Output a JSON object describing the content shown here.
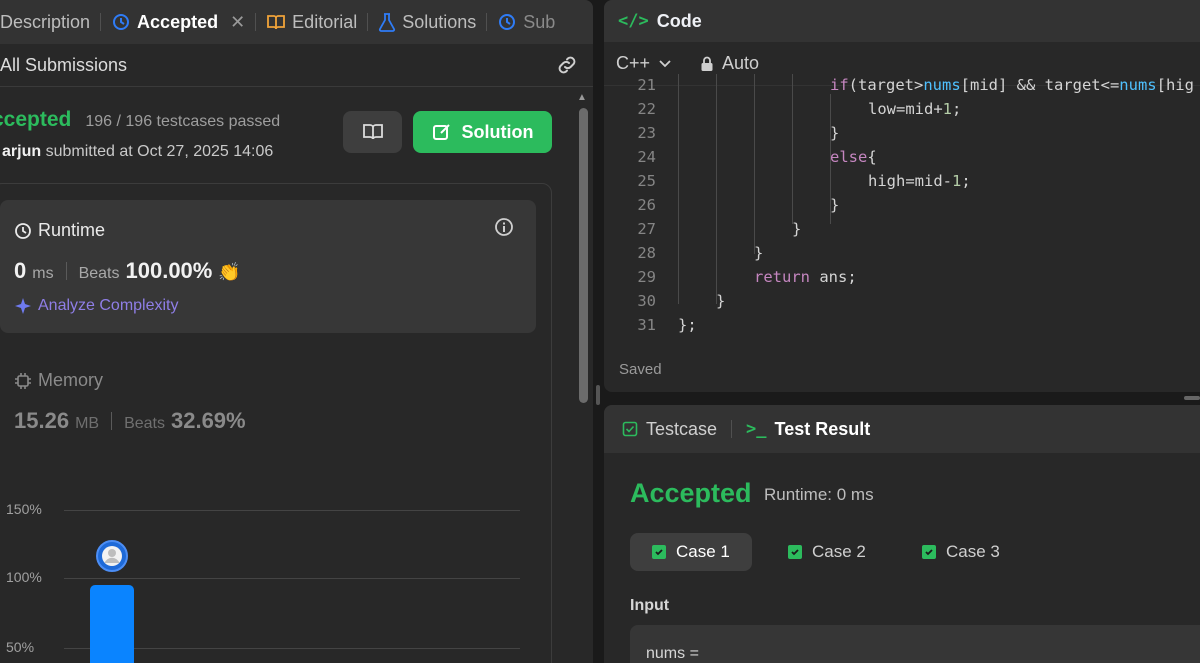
{
  "tabs": [
    {
      "label": "Description",
      "active": false
    },
    {
      "label": "Accepted",
      "active": true
    },
    {
      "label": "Editorial",
      "active": false
    },
    {
      "label": "Solutions",
      "active": false
    },
    {
      "label": "Sub",
      "active": false
    }
  ],
  "submissions": {
    "header": "All Submissions",
    "status": "ccepted",
    "testcases": "196 / 196 testcases passed",
    "user": "arjun",
    "submitted_text": "submitted at Oct 27, 2025 14:06",
    "solution_label": "Solution"
  },
  "runtime": {
    "title": "Runtime",
    "value": "0",
    "unit": "ms",
    "beats_label": "Beats",
    "beats_value": "100.00%",
    "analyze_label": "Analyze Complexity"
  },
  "memory": {
    "title": "Memory",
    "value": "15.26",
    "unit": "MB",
    "beats_label": "Beats",
    "beats_value": "32.69%"
  },
  "chart_data": {
    "type": "bar",
    "y_ticks": [
      "150%",
      "100%",
      "50%"
    ],
    "ylim": [
      50,
      150
    ],
    "bars": [
      {
        "value": 100,
        "highlighted": true
      }
    ]
  },
  "code": {
    "title": "Code",
    "language": "C++",
    "mode": "Auto",
    "saved": "Saved",
    "lines": [
      {
        "n": "21",
        "text": "if(target>nums[mid] && target<=nums[hig"
      },
      {
        "n": "22",
        "text": "low=mid+1;"
      },
      {
        "n": "23",
        "text": "}"
      },
      {
        "n": "24",
        "text": "else{"
      },
      {
        "n": "25",
        "text": "high=mid-1;"
      },
      {
        "n": "26",
        "text": "}"
      },
      {
        "n": "27",
        "text": "}"
      },
      {
        "n": "28",
        "text": "}"
      },
      {
        "n": "29",
        "text": "return ans;"
      },
      {
        "n": "30",
        "text": "}"
      },
      {
        "n": "31",
        "text": "};"
      }
    ]
  },
  "result": {
    "tab_testcase": "Testcase",
    "tab_result": "Test Result",
    "status": "Accepted",
    "runtime": "Runtime: 0 ms",
    "cases": [
      "Case 1",
      "Case 2",
      "Case 3"
    ],
    "input_label": "Input",
    "input_text": "nums ="
  },
  "colors": {
    "accent_green": "#2cbb5d",
    "bar_blue": "#0a84ff",
    "analyze_purple": "#8f7ee6"
  }
}
